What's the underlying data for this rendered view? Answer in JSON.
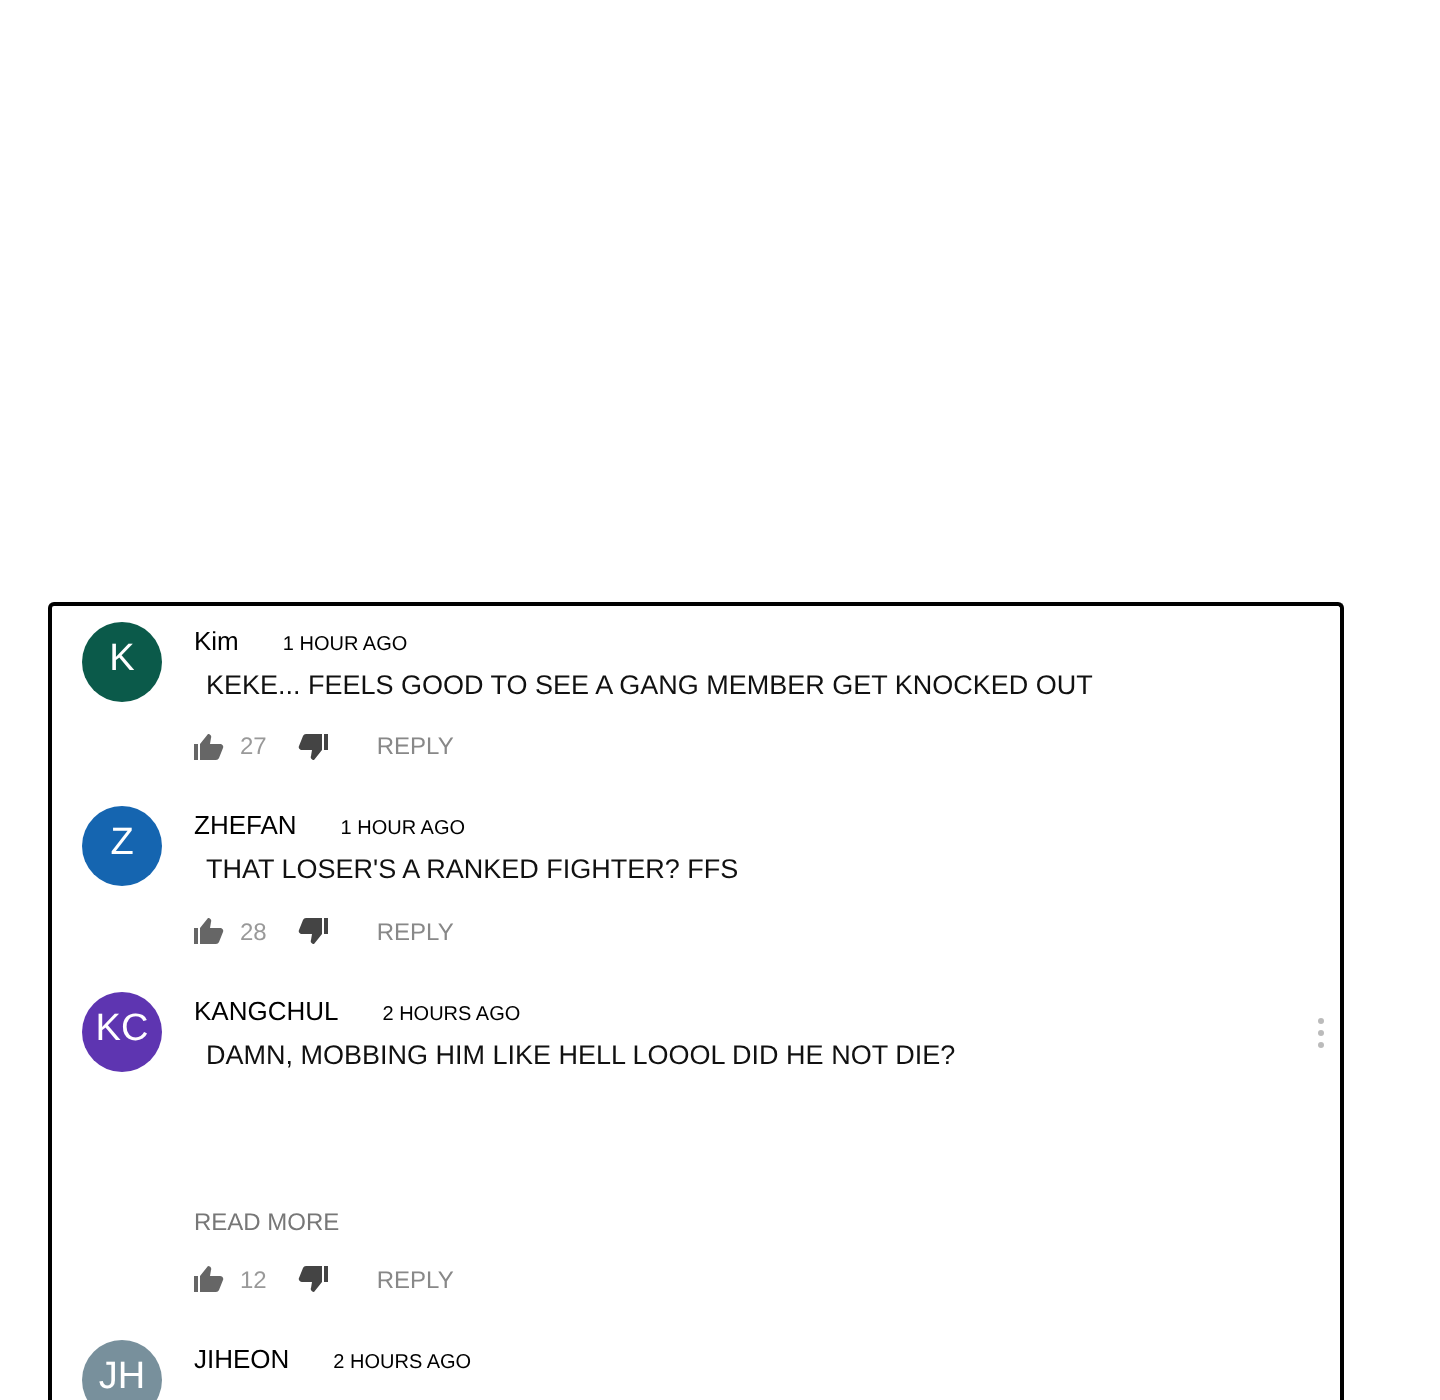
{
  "comments": [
    {
      "initials": "K",
      "color": "#0b5a4a",
      "author": "Kim",
      "time": "1 HOUR AGO",
      "text": "KEKE... FEELS GOOD TO SEE A GANG MEMBER GET KNOCKED OUT",
      "likes": "27",
      "reply": "REPLY",
      "menu": false
    },
    {
      "initials": "Z",
      "color": "#1565b0",
      "author": "ZHEFAN",
      "time": "1 HOUR AGO",
      "text": "THAT LOSER'S A RANKED FIGHTER? FFS",
      "likes": "28",
      "reply": "REPLY",
      "menu": false
    },
    {
      "initials": "KC",
      "color": "#5e35b1",
      "author": "KANGCHUL",
      "time": "2 HOURS AGO",
      "text": "DAMN, MOBBING HIM LIKE HELL LOOOL DID HE NOT DIE?",
      "read_more": "READ MORE",
      "likes": "12",
      "reply": "REPLY",
      "menu": true
    },
    {
      "initials": "JH",
      "color": "#78909c",
      "author": "JIHEON",
      "time": "2 HOURS AGO",
      "menu": false
    }
  ]
}
